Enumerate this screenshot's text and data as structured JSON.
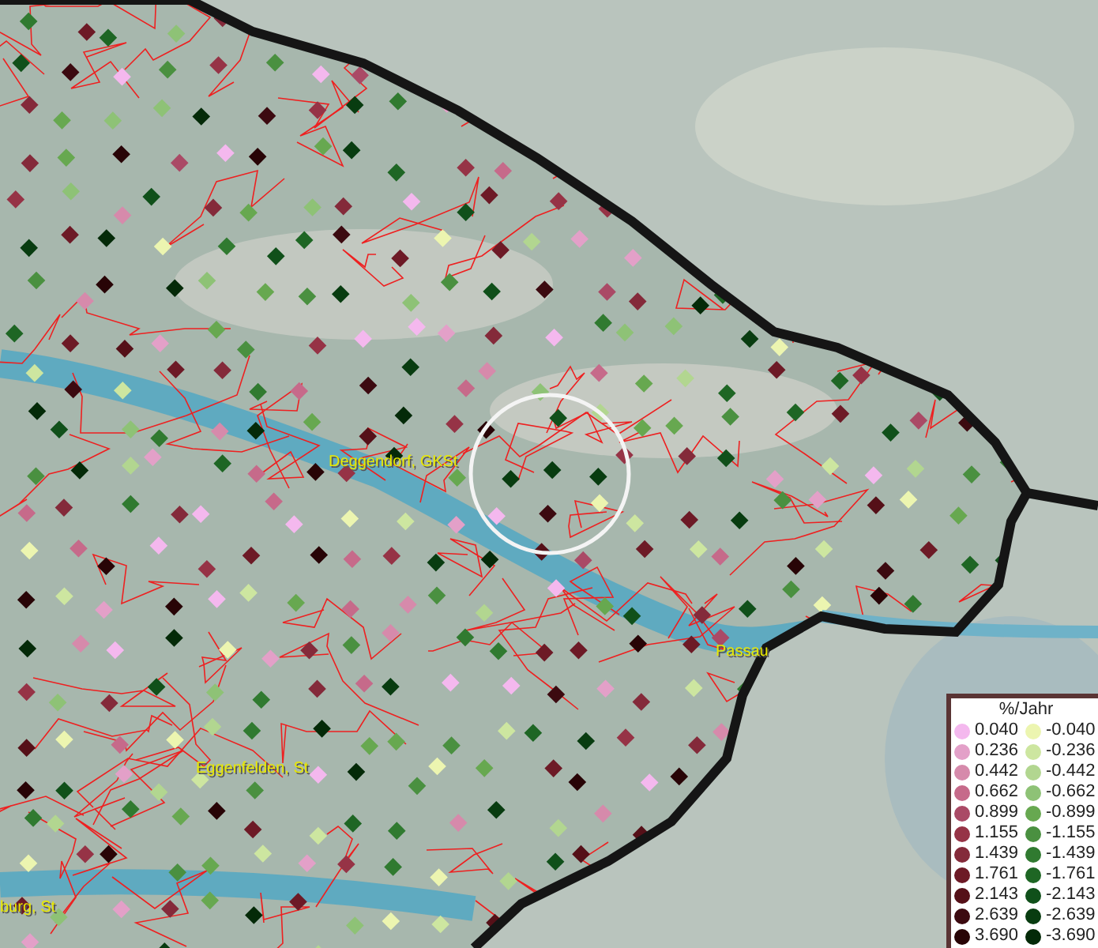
{
  "map": {
    "places": [
      {
        "name": "Deggendorf, GKSt"
      },
      {
        "name": "Passau"
      },
      {
        "name": "Eggenfelden, St"
      },
      {
        "name": "burg, St"
      }
    ]
  },
  "legend": {
    "title": "%/Jahr",
    "items": [
      {
        "value": "0.040",
        "color": "#f4b8ee"
      },
      {
        "value": "-0.040",
        "color": "#ecf5b0"
      },
      {
        "value": "0.236",
        "color": "#e3a0c8"
      },
      {
        "value": "-0.236",
        "color": "#cde6a0"
      },
      {
        "value": "0.442",
        "color": "#d68aab"
      },
      {
        "value": "-0.442",
        "color": "#b2d690"
      },
      {
        "value": "0.662",
        "color": "#c66a8a"
      },
      {
        "value": "-0.662",
        "color": "#8ec276"
      },
      {
        "value": "0.899",
        "color": "#aa4a66"
      },
      {
        "value": "-0.899",
        "color": "#67a850"
      },
      {
        "value": "1.155",
        "color": "#963346"
      },
      {
        "value": "-1.155",
        "color": "#4a9040"
      },
      {
        "value": "1.439",
        "color": "#842a3a"
      },
      {
        "value": "-1.439",
        "color": "#307a30"
      },
      {
        "value": "1.761",
        "color": "#6d1a26"
      },
      {
        "value": "-1.761",
        "color": "#1e6624"
      },
      {
        "value": "2.143",
        "color": "#551018"
      },
      {
        "value": "-2.143",
        "color": "#10501a"
      },
      {
        "value": "2.639",
        "color": "#3c0a10"
      },
      {
        "value": "-2.639",
        "color": "#083c10"
      },
      {
        "value": "3.690",
        "color": "#280406"
      },
      {
        "value": "-3.690",
        "color": "#042a08"
      }
    ]
  }
}
